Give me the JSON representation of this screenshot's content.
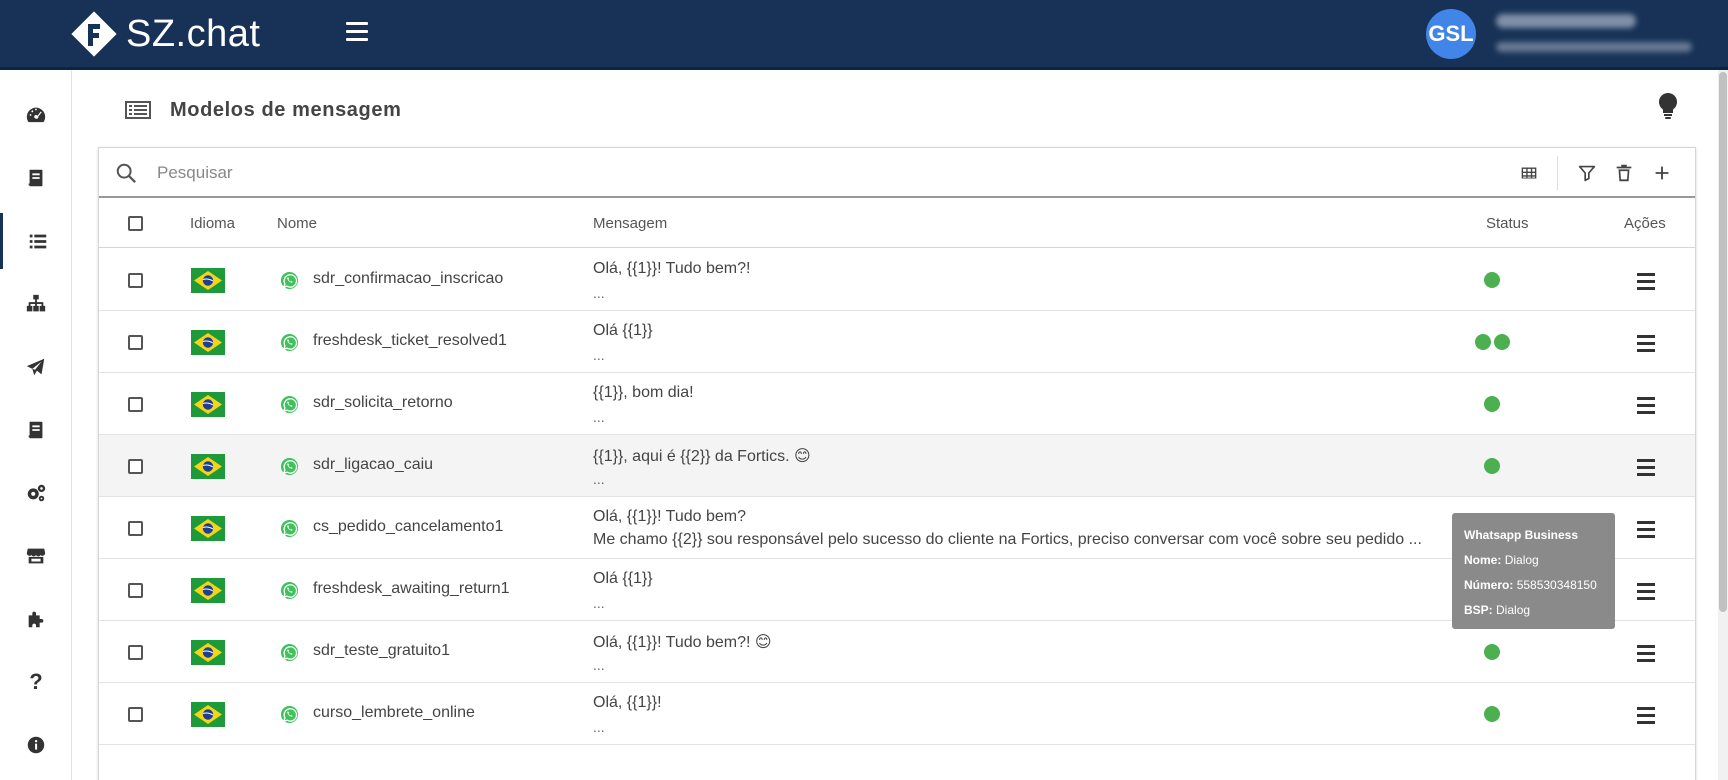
{
  "app": {
    "logo_text": "SZ.chat",
    "user_initials": "GSL"
  },
  "page": {
    "title": "Modelos de mensagem"
  },
  "search": {
    "placeholder": "Pesquisar"
  },
  "table": {
    "headers": {
      "language": "Idioma",
      "name": "Nome",
      "message": "Mensagem",
      "status": "Status",
      "actions": "Ações"
    },
    "rows": [
      {
        "name": "sdr_confirmacao_inscricao",
        "line1": "Olá, {{1}}! Tudo bem?!",
        "line2": "...",
        "status_count": 1
      },
      {
        "name": "freshdesk_ticket_resolved1",
        "line1": "Olá {{1}}",
        "line2": "...",
        "status_count": 2
      },
      {
        "name": "sdr_solicita_retorno",
        "line1": "{{1}}, bom dia!",
        "line2": "...",
        "status_count": 1
      },
      {
        "name": "sdr_ligacao_caiu",
        "line1": "{{1}}, aqui é {{2}} da Fortics. 😊",
        "line2": "...",
        "status_count": 1
      },
      {
        "name": "cs_pedido_cancelamento1",
        "line1": "Olá, {{1}}! Tudo bem?",
        "line2": "Me chamo {{2}} sou responsável pelo sucesso do cliente na Fortics, preciso conversar com você sobre seu pedido ...",
        "status_count": 1
      },
      {
        "name": "freshdesk_awaiting_return1",
        "line1": "Olá {{1}}",
        "line2": "...",
        "status_count": 2
      },
      {
        "name": "sdr_teste_gratuito1",
        "line1": "Olá, {{1}}! Tudo bem?! 😊",
        "line2": "...",
        "status_count": 1
      },
      {
        "name": "curso_lembrete_online",
        "line1": "Olá, {{1}}!",
        "line2": "...",
        "status_count": 1
      }
    ]
  },
  "tooltip": {
    "title": "Whatsapp Business",
    "name_label": "Nome:",
    "name_value": "Dialog",
    "number_label": "Número:",
    "number_value": "558530348150",
    "bsp_label": "BSP:",
    "bsp_value": "Dialog"
  },
  "colors": {
    "topbar": "#173256",
    "status_green": "#4cb050",
    "avatar": "#4285e8"
  },
  "icons": {
    "sidebar": [
      "dashboard-icon",
      "book-icon",
      "list-icon",
      "sitemap-icon",
      "send-icon",
      "book-icon",
      "cogs-icon",
      "store-icon",
      "puzzle-icon",
      "question-icon",
      "info-icon"
    ]
  }
}
